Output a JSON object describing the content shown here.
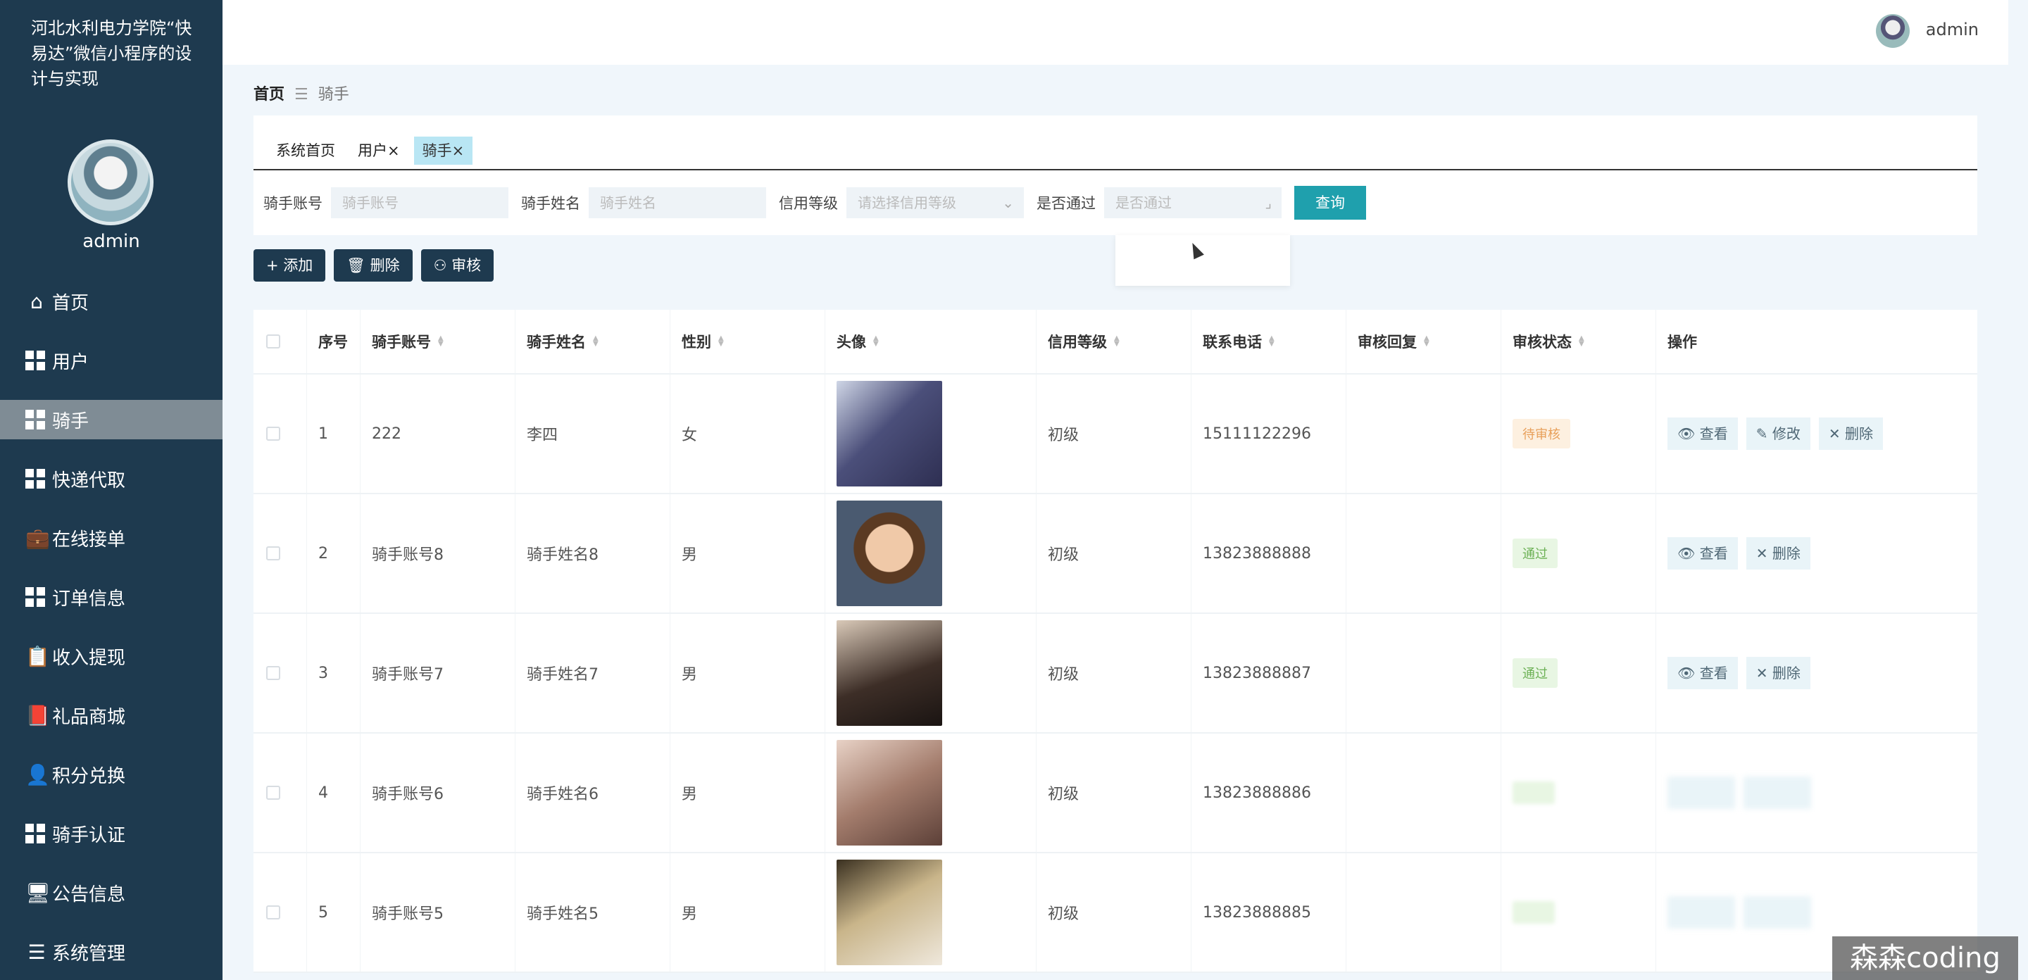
{
  "app": {
    "title": "河北水利电力学院“快易达”微信小程序的设计与实现",
    "user": "admin"
  },
  "sidebar": {
    "items": [
      {
        "label": "首页",
        "icon": "home-icon"
      },
      {
        "label": "用户",
        "icon": "grid-icon"
      },
      {
        "label": "骑手",
        "icon": "grid-icon",
        "active": true
      },
      {
        "label": "快递代取",
        "icon": "grid-icon"
      },
      {
        "label": "在线接单",
        "icon": "briefcase-icon"
      },
      {
        "label": "订单信息",
        "icon": "grid-nine-icon"
      },
      {
        "label": "收入提现",
        "icon": "clipboard-icon"
      },
      {
        "label": "礼品商城",
        "icon": "book-icon"
      },
      {
        "label": "积分兑换",
        "icon": "person-icon"
      },
      {
        "label": "骑手认证",
        "icon": "grid-icon"
      },
      {
        "label": "公告信息",
        "icon": "monitor-icon"
      },
      {
        "label": "系统管理",
        "icon": "list-icon"
      }
    ]
  },
  "breadcrumb": {
    "home": "首页",
    "current": "骑手"
  },
  "tabs": [
    "系统首页",
    "用户×",
    "骑手×"
  ],
  "search": {
    "account_label": "骑手账号",
    "account_placeholder": "骑手账号",
    "name_label": "骑手姓名",
    "name_placeholder": "骑手姓名",
    "credit_label": "信用等级",
    "credit_placeholder": "请选择信用等级",
    "passed_label": "是否通过",
    "passed_placeholder": "是否通过",
    "query_label": "查询"
  },
  "toolbar": {
    "add_label": "+ 添加",
    "delete_label": "删除",
    "audit_label": "审核"
  },
  "table": {
    "columns": [
      "",
      "序号",
      "骑手账号",
      "骑手姓名",
      "性别",
      "头像",
      "信用等级",
      "联系电话",
      "审核回复",
      "审核状态",
      "操作"
    ],
    "rows": [
      {
        "no": "1",
        "account": "222",
        "name": "李四",
        "gender": "女",
        "credit": "初级",
        "phone": "15111122296",
        "reply": "",
        "status": "待审核",
        "status_type": "pending",
        "ops": [
          "查看",
          "修改",
          "删除"
        ]
      },
      {
        "no": "2",
        "account": "骑手账号8",
        "name": "骑手姓名8",
        "gender": "男",
        "credit": "初级",
        "phone": "13823888888",
        "reply": "",
        "status": "通过",
        "status_type": "pass",
        "ops": [
          "查看",
          "删除"
        ]
      },
      {
        "no": "3",
        "account": "骑手账号7",
        "name": "骑手姓名7",
        "gender": "男",
        "credit": "初级",
        "phone": "13823888887",
        "reply": "",
        "status": "通过",
        "status_type": "pass",
        "ops": [
          "查看",
          "删除"
        ]
      },
      {
        "no": "4",
        "account": "骑手账号6",
        "name": "骑手姓名6",
        "gender": "男",
        "credit": "初级",
        "phone": "13823888886",
        "reply": "",
        "status": "",
        "status_type": "pass",
        "ops": []
      },
      {
        "no": "5",
        "account": "骑手账号5",
        "name": "骑手姓名5",
        "gender": "男",
        "credit": "初级",
        "phone": "13823888885",
        "reply": "",
        "status": "",
        "status_type": "pass",
        "ops": []
      }
    ]
  },
  "watermark": "森森coding"
}
